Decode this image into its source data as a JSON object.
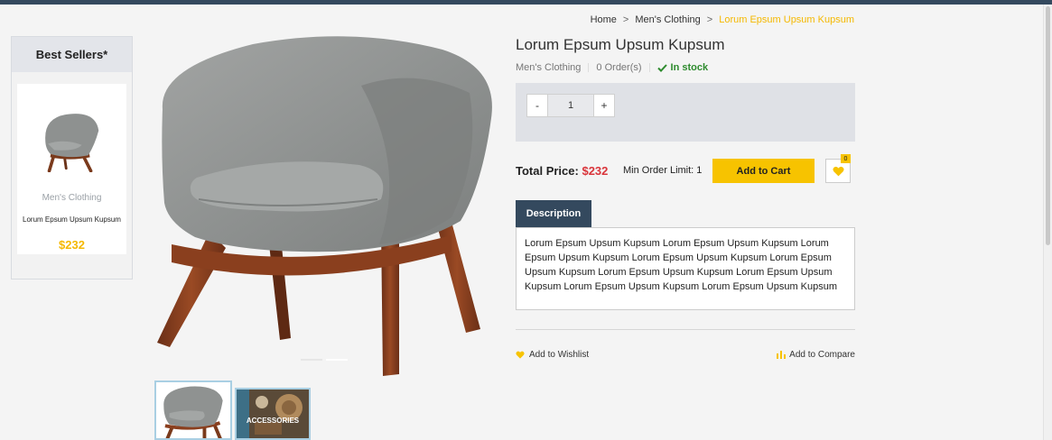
{
  "breadcrumb": {
    "home": "Home",
    "separator": ">",
    "category": "Men's Clothing",
    "current": "Lorum Epsum Upsum Kupsum"
  },
  "sidebar": {
    "title": "Best Sellers*",
    "item": {
      "category": "Men's Clothing",
      "name": "Lorum Epsum Upsum Kupsum",
      "price": "$232"
    }
  },
  "gallery": {
    "thumbnails": [
      {
        "label": ""
      },
      {
        "label": "ACCESSORIES"
      }
    ]
  },
  "product": {
    "title": "Lorum Epsum Upsum Kupsum",
    "category": "Men's Clothing",
    "orders": "0 Order(s)",
    "stock": "In stock",
    "quantity": "1",
    "minus_label": "-",
    "plus_label": "+",
    "total_label": "Total Price:",
    "total_price": "$232",
    "min_order": "Min Order Limit: 1",
    "add_to_cart": "Add to Cart",
    "wishlist_count": "0",
    "description_tab": "Description",
    "description": "Lorum Epsum Upsum Kupsum Lorum Epsum Upsum Kupsum Lorum Epsum Upsum Kupsum Lorum Epsum Upsum Kupsum Lorum Epsum Upsum Kupsum Lorum Epsum Upsum Kupsum Lorum Epsum Upsum Kupsum Lorum Epsum Upsum Kupsum Lorum Epsum Upsum Kupsum",
    "add_to_wishlist": "Add to Wishlist",
    "add_to_compare": "Add to Compare"
  },
  "colors": {
    "accent": "#f7c300",
    "price": "#d9343a",
    "tab": "#34495e",
    "stock": "#2e8b2e"
  },
  "icons": [
    "check-icon",
    "heart-icon",
    "compare-bars-icon"
  ]
}
